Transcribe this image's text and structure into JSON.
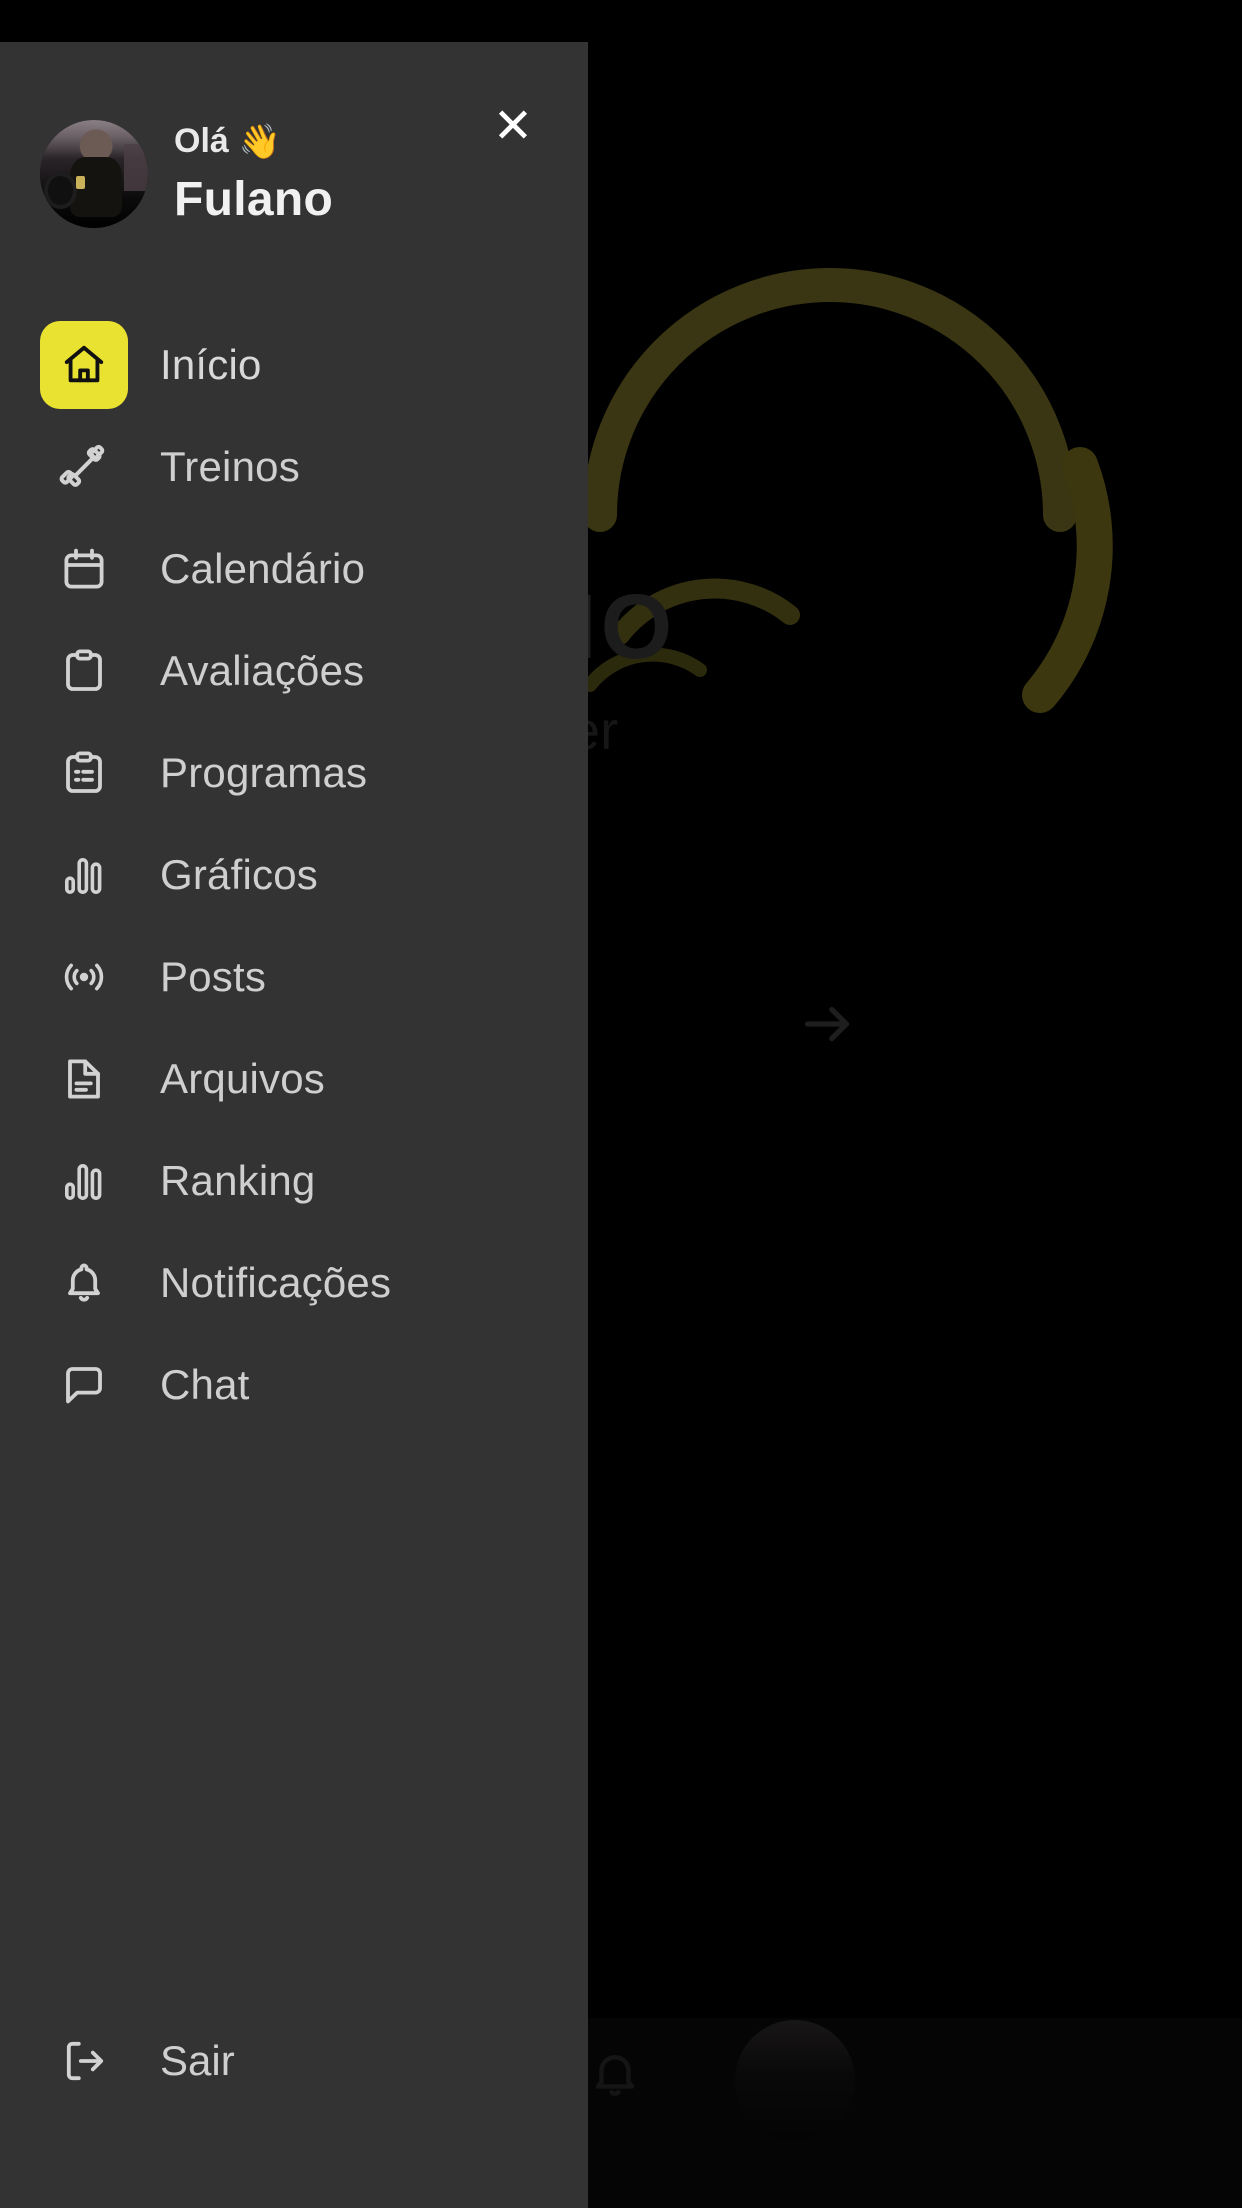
{
  "drawer": {
    "close_label": "✕",
    "profile": {
      "greeting": "Olá",
      "wave_emoji": "👋",
      "name": "Fulano",
      "avatar_alt": "user-photo"
    },
    "items": [
      {
        "id": "inicio",
        "label": "Início",
        "icon": "home-icon",
        "active": true
      },
      {
        "id": "treinos",
        "label": "Treinos",
        "icon": "dumbbell-icon",
        "active": false
      },
      {
        "id": "calendario",
        "label": "Calendário",
        "icon": "calendar-icon",
        "active": false
      },
      {
        "id": "avaliacoes",
        "label": "Avaliações",
        "icon": "clipboard-icon",
        "active": false
      },
      {
        "id": "programas",
        "label": "Programas",
        "icon": "clipboard-list-icon",
        "active": false
      },
      {
        "id": "graficos",
        "label": "Gráficos",
        "icon": "bar-chart-icon",
        "active": false
      },
      {
        "id": "posts",
        "label": "Posts",
        "icon": "broadcast-icon",
        "active": false
      },
      {
        "id": "arquivos",
        "label": "Arquivos",
        "icon": "document-icon",
        "active": false
      },
      {
        "id": "ranking",
        "label": "Ranking",
        "icon": "bar-chart-icon",
        "active": false
      },
      {
        "id": "notificacoes",
        "label": "Notificações",
        "icon": "bell-icon",
        "active": false
      },
      {
        "id": "chat",
        "label": "Chat",
        "icon": "chat-bubble-icon",
        "active": false
      }
    ],
    "logout": {
      "label": "Sair",
      "icon": "logout-icon"
    }
  },
  "background": {
    "brand_text": "LHO",
    "brand_sub": "ner",
    "next_icon": "arrow-right-icon",
    "bottom_bell_icon": "bell-icon",
    "bottom_avatar": "user-avatar"
  },
  "colors": {
    "accent_yellow": "#e9e231",
    "drawer_bg": "#333333",
    "page_bg": "#000000",
    "label_text": "#cfcfcf",
    "title_text": "#f1f1f1"
  }
}
